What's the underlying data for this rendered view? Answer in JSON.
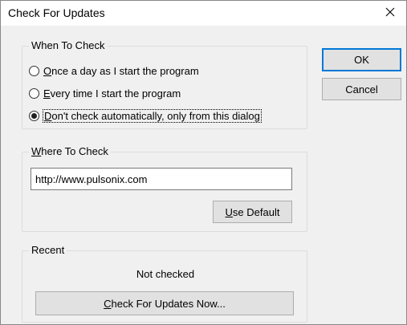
{
  "window": {
    "title": "Check For Updates",
    "close_glyph": "✕"
  },
  "when_group": {
    "legend": "When To Check",
    "options": [
      {
        "mnemonic": "O",
        "rest": "nce a day as I start the program",
        "selected": false
      },
      {
        "mnemonic": "E",
        "rest": "very time I start the program",
        "selected": false
      },
      {
        "mnemonic": "D",
        "rest": "on't check automatically, only from this dialog",
        "selected": true
      }
    ]
  },
  "where_group": {
    "legend_mnemonic": "W",
    "legend_rest": "here To Check",
    "url_value": "http://www.pulsonix.com",
    "use_default_mnemonic": "U",
    "use_default_rest": "se Default"
  },
  "recent_group": {
    "legend": "Recent",
    "status": "Not checked",
    "check_now_mnemonic": "C",
    "check_now_rest": "heck For Updates Now..."
  },
  "buttons": {
    "ok": "OK",
    "cancel": "Cancel"
  },
  "colors": {
    "accent": "#0078d7",
    "background": "#f0f0f0",
    "title_bar": "#ffffff"
  }
}
